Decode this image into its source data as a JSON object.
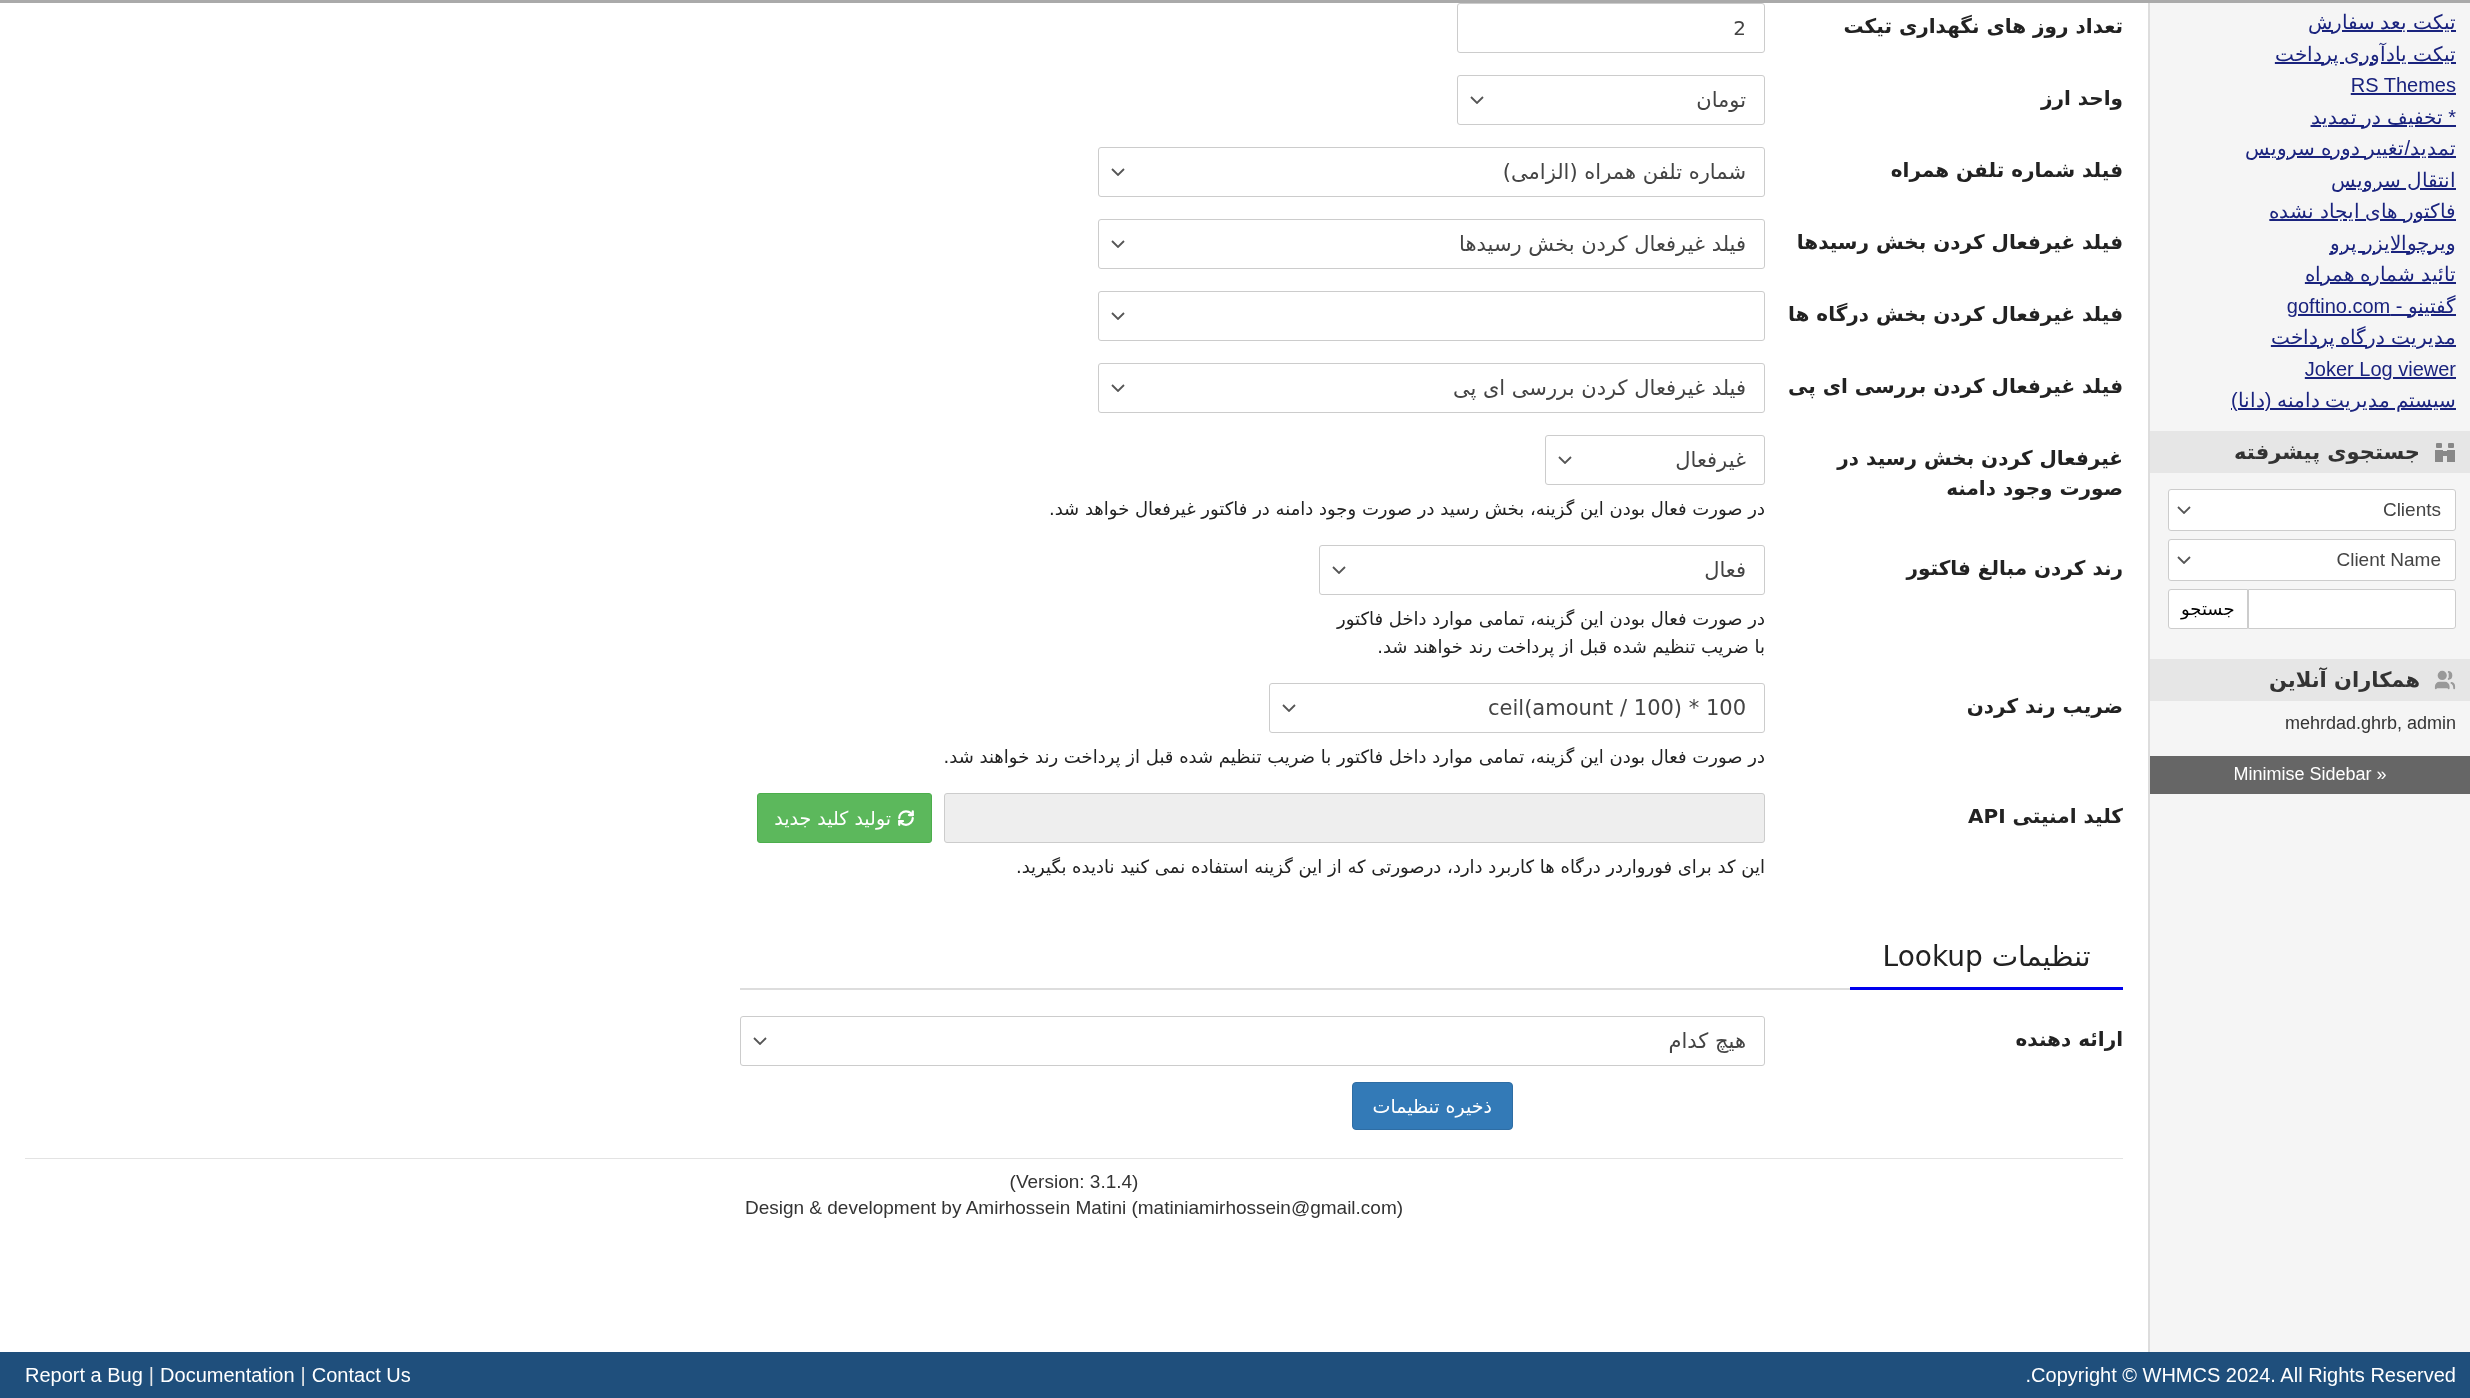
{
  "form": {
    "rows": [
      {
        "kind": "input",
        "label": "تعداد روز های نگهداری تیکت",
        "value": "2"
      },
      {
        "kind": "select",
        "label": "واحد ارز",
        "value": "تومان"
      },
      {
        "kind": "select",
        "label": "فیلد شماره تلفن همراه",
        "value": "شماره تلفن همراه (الزامی)"
      },
      {
        "kind": "select",
        "label": "فیلد غیرفعال کردن بخش رسیدها",
        "value": "فیلد غیرفعال کردن بخش رسیدها"
      },
      {
        "kind": "select",
        "label": "فیلد غیرفعال کردن بخش درگاه ها",
        "value": ""
      },
      {
        "kind": "select",
        "label": "فیلد غیرفعال کردن بررسی ای پی",
        "value": "فیلد غیرفعال کردن بررسی ای پی"
      },
      {
        "kind": "select",
        "label": "غیرفعال کردن بخش رسید در صورت وجود دامنه",
        "value": "غیرفعال",
        "help": "در صورت فعال بودن این گزینه، بخش رسید در صورت وجود دامنه در فاکتور غیرفعال خواهد شد."
      },
      {
        "kind": "select",
        "label": "رند کردن مبالغ فاکتور",
        "value": "فعال",
        "help": "در صورت فعال بودن این گزینه، تمامی موارد داخل فاکتور با ضریب تنظیم شده قبل از پرداخت رند خواهند شد."
      },
      {
        "kind": "select",
        "label": "ضریب رند کردن",
        "value": "ceil(amount / 100) * 100",
        "help": "در صورت فعال بودن این گزینه، تمامی موارد داخل فاکتور با ضریب تنظیم شده قبل از پرداخت رند خواهند شد."
      },
      {
        "kind": "api",
        "label": "کلید امنیتی API",
        "disabled": true,
        "button": "تولید کلید جدید",
        "help": "این کد برای فورواردر درگاه ها کاربرد دارد، درصورتی که از این گزینه استفاده نمی کنید نادیده بگیرید."
      }
    ]
  },
  "tabs": [
    {
      "label": "تنظیمات Lookup",
      "selected": true
    }
  ],
  "lookup": {
    "label": "ارائه دهنده",
    "value": "هیچ کدام"
  },
  "save_button": "ذخیره تنظیمات",
  "version": "(Version: 3.1.4)",
  "credit": "Design & development by Amirhossein Matini (matiniamirhossein@gmail.com)",
  "sidebar": {
    "links": [
      "تیکت بعد سفارش",
      "تیکت یادآوری پرداخت",
      "RS Themes",
      "* تخفیف در تمدید",
      "تمدید/تغییر دوره سرویس",
      "انتقال سرویس",
      "فاکتور های ایجاد نشده",
      "ویرچوالایزر پرو",
      "تائید شماره همراه",
      "گفتینو - goftino.com",
      "مدیریت درگاه پرداخت",
      "Joker Log viewer",
      "سیستم مدیریت دامنه (دانا)"
    ],
    "search": {
      "title": "جستجوی پیشرفته",
      "type": "Clients",
      "field": "Client Name",
      "button": "جستجو"
    },
    "online": {
      "title": "همکاران آنلاین",
      "users": "mehrdad.ghrb, admin"
    },
    "minimise": "Minimise Sidebar »"
  },
  "footer": {
    "items": [
      {
        "kind": "link",
        "text": "Contact Us"
      },
      {
        "kind": "separator",
        "text": "|"
      },
      {
        "kind": "link",
        "text": "Documentation"
      },
      {
        "kind": "separator",
        "text": "|"
      },
      {
        "kind": "link",
        "text": "Report a Bug"
      }
    ],
    "copyright": ".Copyright © WHMCS 2024. All Rights Reserved"
  }
}
